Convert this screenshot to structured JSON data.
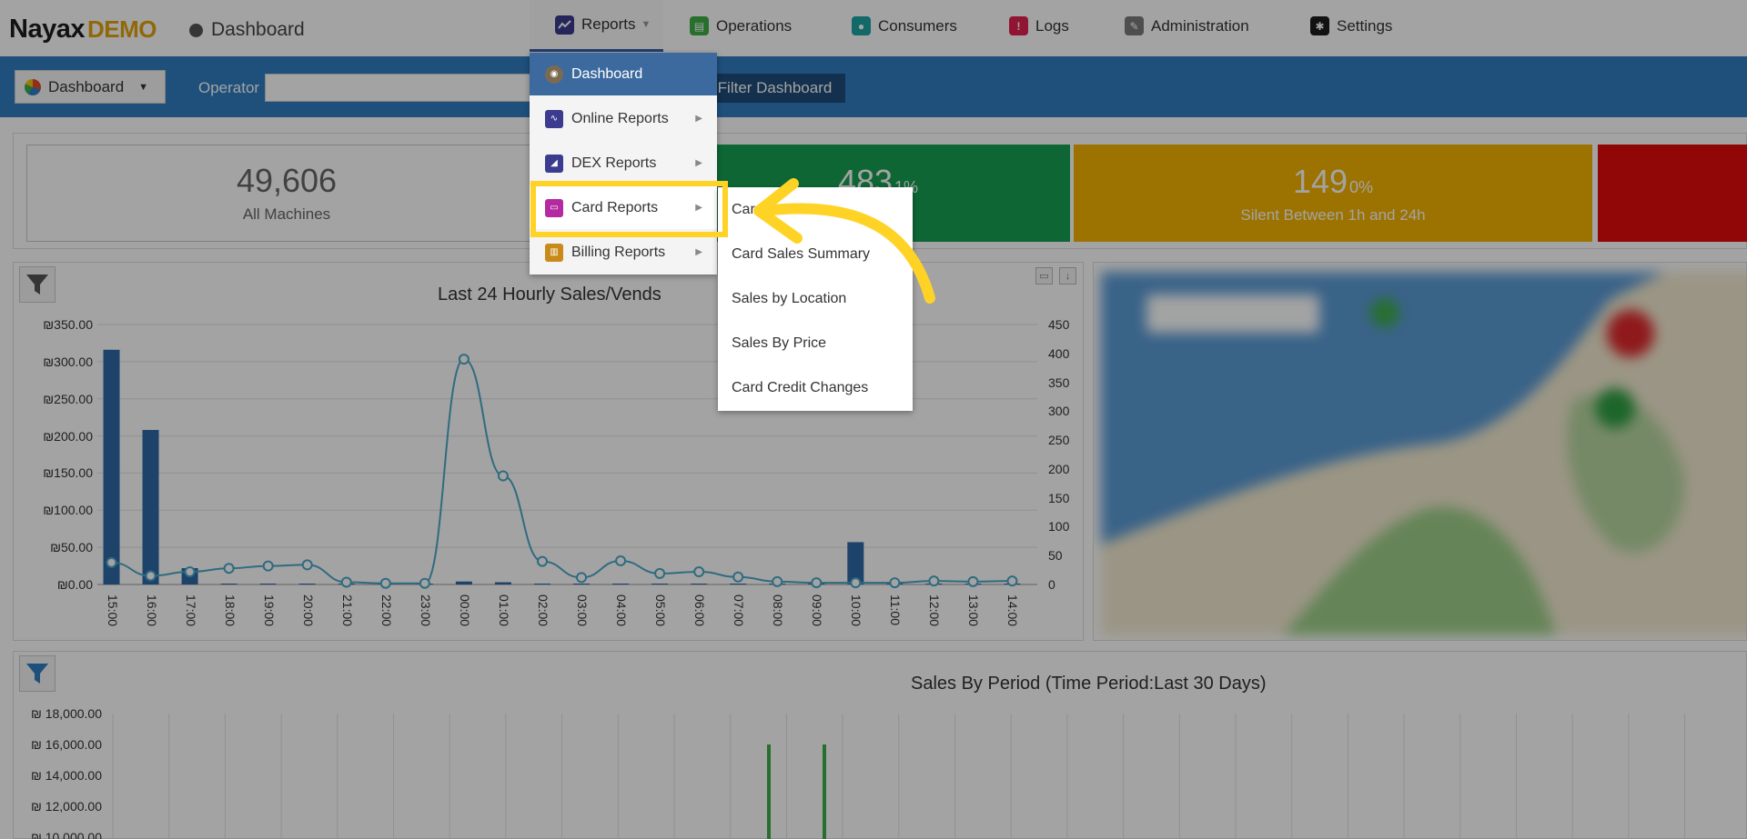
{
  "header": {
    "brand": "Nayax",
    "brand_suffix": "DEMO",
    "current_page": "Dashboard",
    "nav": [
      {
        "label": "Reports",
        "icon": "line-chart-icon",
        "color": "#3b3b8f"
      },
      {
        "label": "Operations",
        "icon": "clipboard-icon",
        "color": "#3fae49"
      },
      {
        "label": "Consumers",
        "icon": "people-icon",
        "color": "#1fa3a3"
      },
      {
        "label": "Logs",
        "icon": "alert-icon",
        "color": "#e0214f"
      },
      {
        "label": "Administration",
        "icon": "wrench-icon",
        "color": "#7a7a7a"
      },
      {
        "label": "Settings",
        "icon": "gear-icon",
        "color": "#1d1d1d"
      }
    ]
  },
  "filterbar": {
    "dashboard_select": "Dashboard",
    "operator_label": "Operator",
    "operator_value": "",
    "filter_button": "Filter Dashboard"
  },
  "stats": [
    {
      "value": "49,606",
      "pct": "",
      "label": "All Machines"
    },
    {
      "value": "483",
      "pct": "1%",
      "label": ""
    },
    {
      "value": "149",
      "pct": "0%",
      "label": "Silent Between 1h and 24h"
    }
  ],
  "reports_menu": {
    "items": [
      {
        "label": "Dashboard",
        "icon": "dashboard-icon",
        "has_submenu": false
      },
      {
        "label": "Online Reports",
        "icon": "online-reports-icon",
        "has_submenu": true
      },
      {
        "label": "DEX Reports",
        "icon": "dex-reports-icon",
        "has_submenu": true
      },
      {
        "label": "Card Reports",
        "icon": "card-icon",
        "has_submenu": true
      },
      {
        "label": "Billing Reports",
        "icon": "billing-icon",
        "has_submenu": true
      }
    ]
  },
  "card_submenu": {
    "items": [
      "Card Details",
      "Card Sales Summary",
      "Sales by Location",
      "Sales By Price",
      "Card Credit Changes"
    ]
  },
  "chart_data": [
    {
      "type": "bar",
      "title": "Last 24 Hourly Sales/Vends",
      "categories": [
        "15:00",
        "16:00",
        "17:00",
        "18:00",
        "19:00",
        "20:00",
        "21:00",
        "22:00",
        "23:00",
        "00:00",
        "01:00",
        "02:00",
        "03:00",
        "04:00",
        "05:00",
        "06:00",
        "07:00",
        "08:00",
        "09:00",
        "10:00",
        "11:00",
        "12:00",
        "13:00",
        "14:00"
      ],
      "y_ticks_left": [
        "₪0.00",
        "₪50.00",
        "₪100.00",
        "₪150.00",
        "₪200.00",
        "₪250.00",
        "₪300.00",
        "₪350.00"
      ],
      "y_ticks_right": [
        "0",
        "50",
        "100",
        "150",
        "200",
        "250",
        "300",
        "350",
        "400",
        "450"
      ],
      "ylim": [
        0,
        350
      ],
      "ylim_right": [
        0,
        450
      ],
      "series": [
        {
          "type": "bar",
          "values": [
            316,
            208,
            22,
            1,
            1,
            1,
            0,
            0,
            1,
            4,
            3,
            1,
            0,
            1,
            0,
            0,
            0,
            0,
            1,
            57,
            0,
            0,
            0,
            1
          ]
        },
        {
          "type": "line",
          "axis": "right",
          "values": [
            38,
            15,
            22,
            28,
            32,
            34,
            4,
            2,
            2,
            390,
            188,
            40,
            12,
            41,
            19,
            22,
            13,
            5,
            3,
            3,
            3,
            6,
            5,
            6
          ]
        }
      ],
      "colors": {
        "bar": "#2e6aa8",
        "line": "#4aa8c8"
      }
    },
    {
      "type": "bar",
      "title": "Sales By Period (Time Period:Last 30 Days)",
      "y_ticks": [
        "₪ 10,000.00",
        "₪ 12,000.00",
        "₪ 14,000.00",
        "₪ 16,000.00",
        "₪ 18,000.00"
      ],
      "values": [
        16000,
        16000
      ],
      "colors": {
        "bar": "#3fae49"
      }
    }
  ]
}
